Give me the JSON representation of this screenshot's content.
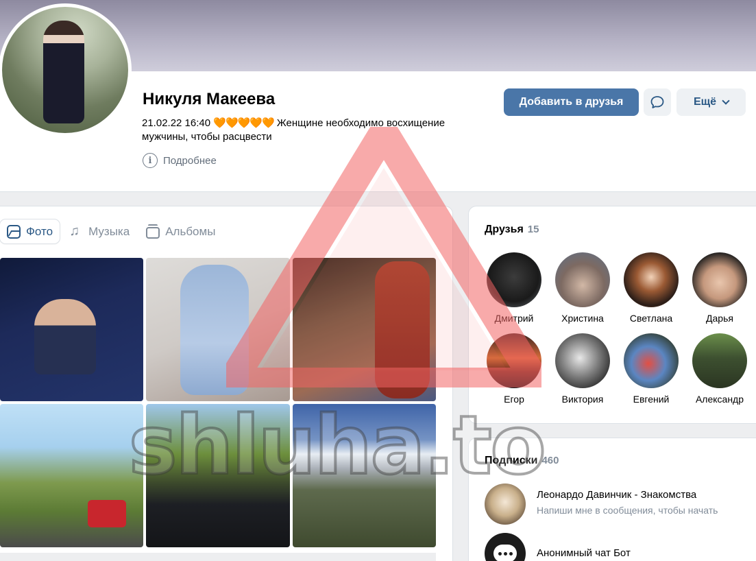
{
  "profile": {
    "name": "Никуля Макеева",
    "status_line1": "21.02.22 16:40",
    "status_hearts": "🧡🧡🧡🧡🧡",
    "status_line1_tail": "Женщине необходимо восхищение",
    "status_line2": "мужчины, чтобы расцвести",
    "more_info": "Подробнее"
  },
  "actions": {
    "add_friend": "Добавить в друзья",
    "more": "Ещё"
  },
  "media": {
    "tabs": [
      {
        "label": "Фото",
        "active": true
      },
      {
        "label": "Музыка",
        "active": false
      },
      {
        "label": "Альбомы",
        "active": false
      }
    ]
  },
  "friends": {
    "title": "Друзья",
    "count": "15",
    "items": [
      {
        "name": "Дмитрий"
      },
      {
        "name": "Христина"
      },
      {
        "name": "Светлана"
      },
      {
        "name": "Дарья"
      },
      {
        "name": "Егор"
      },
      {
        "name": "Виктория"
      },
      {
        "name": "Евгений"
      },
      {
        "name": "Александр"
      }
    ]
  },
  "subscriptions": {
    "title": "Подписки",
    "count": "460",
    "items": [
      {
        "name": "Леонардо Давинчик - Знакомства",
        "desc": "Напиши мне в сообщения, чтобы начать"
      },
      {
        "name": "Анонимный чат Бот",
        "desc": ""
      }
    ]
  },
  "watermark": {
    "text": "shluha.to",
    "icon": "warning-triangle-icon"
  },
  "colors": {
    "primary_button": "#4a76a8",
    "link": "#2a5885",
    "secondary_text": "#818c99",
    "watermark_red": "#f26464"
  }
}
